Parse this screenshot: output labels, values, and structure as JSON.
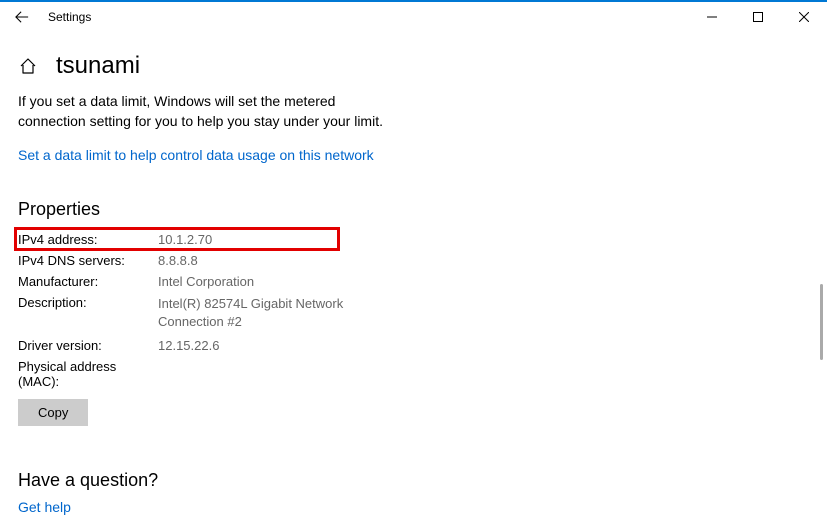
{
  "titlebar": {
    "title": "Settings"
  },
  "page": {
    "title": "tsunami",
    "description": "If you set a data limit, Windows will set the metered connection setting for you to help you stay under your limit.",
    "data_limit_link": "Set a data limit to help control data usage on this network"
  },
  "properties": {
    "heading": "Properties",
    "rows": [
      {
        "label": "IPv4 address:",
        "value": "10.1.2.70"
      },
      {
        "label": "IPv4 DNS servers:",
        "value": "8.8.8.8"
      },
      {
        "label": "Manufacturer:",
        "value": "Intel Corporation"
      },
      {
        "label": "Description:",
        "value": "Intel(R) 82574L Gigabit Network Connection #2"
      },
      {
        "label": "Driver version:",
        "value": "12.15.22.6"
      },
      {
        "label": "Physical address (MAC):",
        "value": ""
      }
    ],
    "copy_label": "Copy"
  },
  "question": {
    "heading": "Have a question?",
    "help_link": "Get help"
  }
}
